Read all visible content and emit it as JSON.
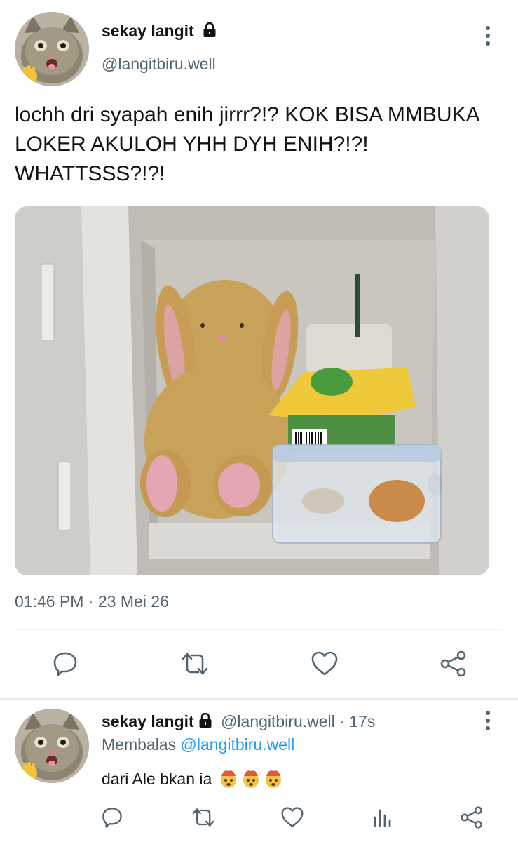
{
  "main_tweet": {
    "display_name": "sekay langit",
    "handle": "@langitbiru.well",
    "text": "lochh dri syapah enih jirrr?!? KOK BISA MMBUKA LOKER AKULOH YHH DYH ENIH?!?! WHATTSSS?!?!",
    "timestamp": "01:46 PM · 23 Mei 26",
    "icons": [
      "lock-icon",
      "kebab-menu-icon",
      "reply-icon",
      "retweet-icon",
      "like-icon",
      "share-icon"
    ]
  },
  "reply": {
    "display_name": "sekay langit",
    "handle": "@langitbiru.well",
    "separator": " · ",
    "time_ago": "17s",
    "replying_prefix": "Membalas",
    "replying_to": "@langitbiru.well",
    "text": "dari Ale bkan ia",
    "icons": [
      "reply-icon",
      "retweet-icon",
      "like-icon",
      "views-icon",
      "share-icon"
    ]
  },
  "colors": {
    "text": "#0f1419",
    "secondary": "#536471",
    "link": "#1d9bf0",
    "divider": "#eff3f4"
  }
}
